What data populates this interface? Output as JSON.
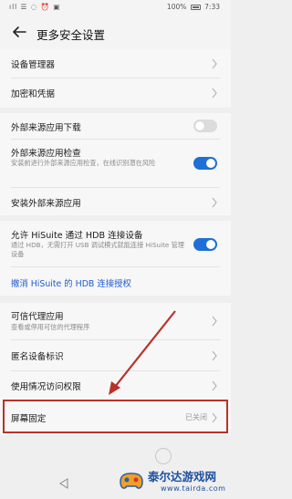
{
  "status_bar": {
    "left_icons": "ıll ☰ ◌ ⏰ ▣",
    "battery": "100%",
    "time": "7:33"
  },
  "header": {
    "title": "更多安全设置"
  },
  "items": {
    "device_manager": "设备管理器",
    "encryption": "加密和凭据",
    "ext_download": "外部来源应用下载",
    "ext_check": "外部来源应用检查",
    "ext_check_desc": "安装前进行外部来源应用检查，在线识别潜在风险",
    "install_ext": "安装外部来源应用",
    "hisuite": "允许 HiSuite 通过 HDB 连接设备",
    "hisuite_desc": "通过 HDB，无需打开 USB 调试模式就能连接 HiSuite 管理设备",
    "revoke": "撤消 HiSuite 的 HDB 连接授权",
    "trust_agent": "可信代理应用",
    "trust_agent_desc": "查看或停用可信的代理程序",
    "anon_id": "匿名设备标识",
    "usage_access": "使用情况访问权限",
    "screen_pin": "屏幕固定",
    "screen_pin_value": "已关闭"
  },
  "toggles": {
    "ext_download": false,
    "ext_check": true,
    "hisuite": true
  },
  "watermark": {
    "name": "泰尔达游戏网",
    "url": "www.tairda.com"
  },
  "colors": {
    "accent": "#1e6fd8",
    "link": "#1e5bd0",
    "annotation": "#b8322a"
  }
}
